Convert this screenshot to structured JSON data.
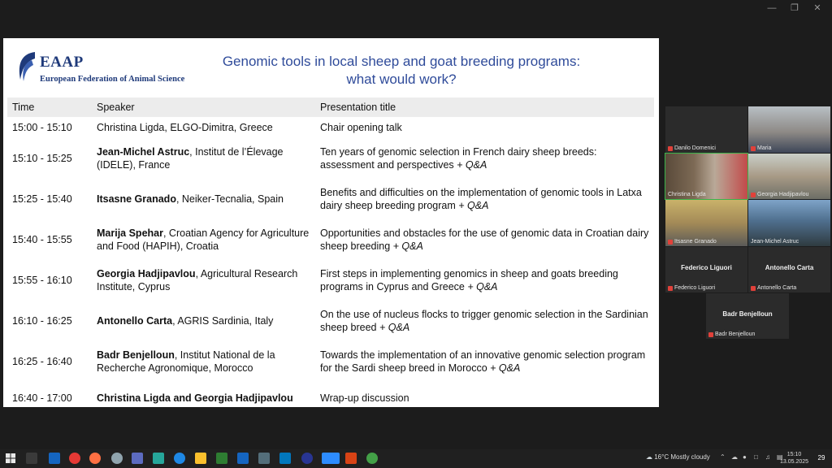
{
  "slide": {
    "logo_abbr": "EAAP",
    "logo_full": "European Federation of Animal Science",
    "title_line1": "Genomic tools in local sheep and goat breeding programs:",
    "title_line2": "what would work?",
    "headers": {
      "time": "Time",
      "speaker": "Speaker",
      "title": "Presentation title"
    },
    "rows": [
      {
        "time": "15:00 - 15:10",
        "speaker_name": "",
        "speaker_rest": "Christina Ligda, ELGO-Dimitra, Greece",
        "title": "Chair opening talk",
        "qa": ""
      },
      {
        "time": "15:10 - 15:25",
        "speaker_name": "Jean-Michel Astruc",
        "speaker_rest": ", Institut de l’Élevage (IDELE), France",
        "title": "Ten years of genomic selection in French dairy sheep breeds: assessment and perspectives",
        "qa": " + Q&A"
      },
      {
        "time": "15:25 - 15:40",
        "speaker_name": "Itsasne Granado",
        "speaker_rest": ", Neiker-Tecnalia, Spain",
        "title": "Benefits and difficulties on the implementation of genomic tools in Latxa dairy sheep breeding program",
        "qa": " + Q&A"
      },
      {
        "time": "15:40 - 15:55",
        "speaker_name": "Marija Spehar",
        "speaker_rest": ", Croatian Agency for Agriculture and Food (HAPIH), Croatia",
        "title": "Opportunities and obstacles for the use of genomic data in Croatian dairy sheep breeding",
        "qa": " + Q&A"
      },
      {
        "time": "15:55 - 16:10",
        "speaker_name": "Georgia Hadjipavlou",
        "speaker_rest": ", Agricultural Research Institute, Cyprus",
        "title": "First steps in implementing genomics in sheep and goats breeding programs in Cyprus and Greece",
        "qa": " + Q&A"
      },
      {
        "time": "16:10 - 16:25",
        "speaker_name": "Antonello Carta",
        "speaker_rest": ", AGRIS Sardinia, Italy",
        "title": "On the use of nucleus flocks to trigger genomic selection in the Sardinian sheep breed",
        "qa": " + Q&A"
      },
      {
        "time": "16:25 - 16:40",
        "speaker_name": "Badr Benjelloun",
        "speaker_rest": ", Institut National de la Recherche Agronomique, Morocco",
        "title": "Towards the implementation of an innovative genomic selection program for the Sardi sheep breed in Morocco",
        "qa": " + Q&A"
      },
      {
        "time": "16:40 - 17:00",
        "speaker_name": "Christina Ligda and Georgia Hadjipavlou",
        "speaker_rest": "",
        "title": "Wrap-up discussion",
        "qa": ""
      }
    ]
  },
  "participants": {
    "danilo": "Danilo Domenici",
    "maria": "Maria",
    "christina": "Christina Ligda",
    "georgia": "Georgia Hadjipavlou",
    "itsasne": "Itsasne Granado",
    "jeanmichel": "Jean-Michel Astruc",
    "federico": "Federico Liguori",
    "antonello": "Antonello Carta",
    "badr": "Badr Benjelloun"
  },
  "taskbar": {
    "weather": "16°C  Mostly cloudy",
    "time": "15:10",
    "date": "13.05.2025",
    "notif_count": "29"
  },
  "colors": {
    "title_blue": "#2f4b9a",
    "active_speaker": "#3bb34a",
    "taskbar_bg": "#202020"
  }
}
